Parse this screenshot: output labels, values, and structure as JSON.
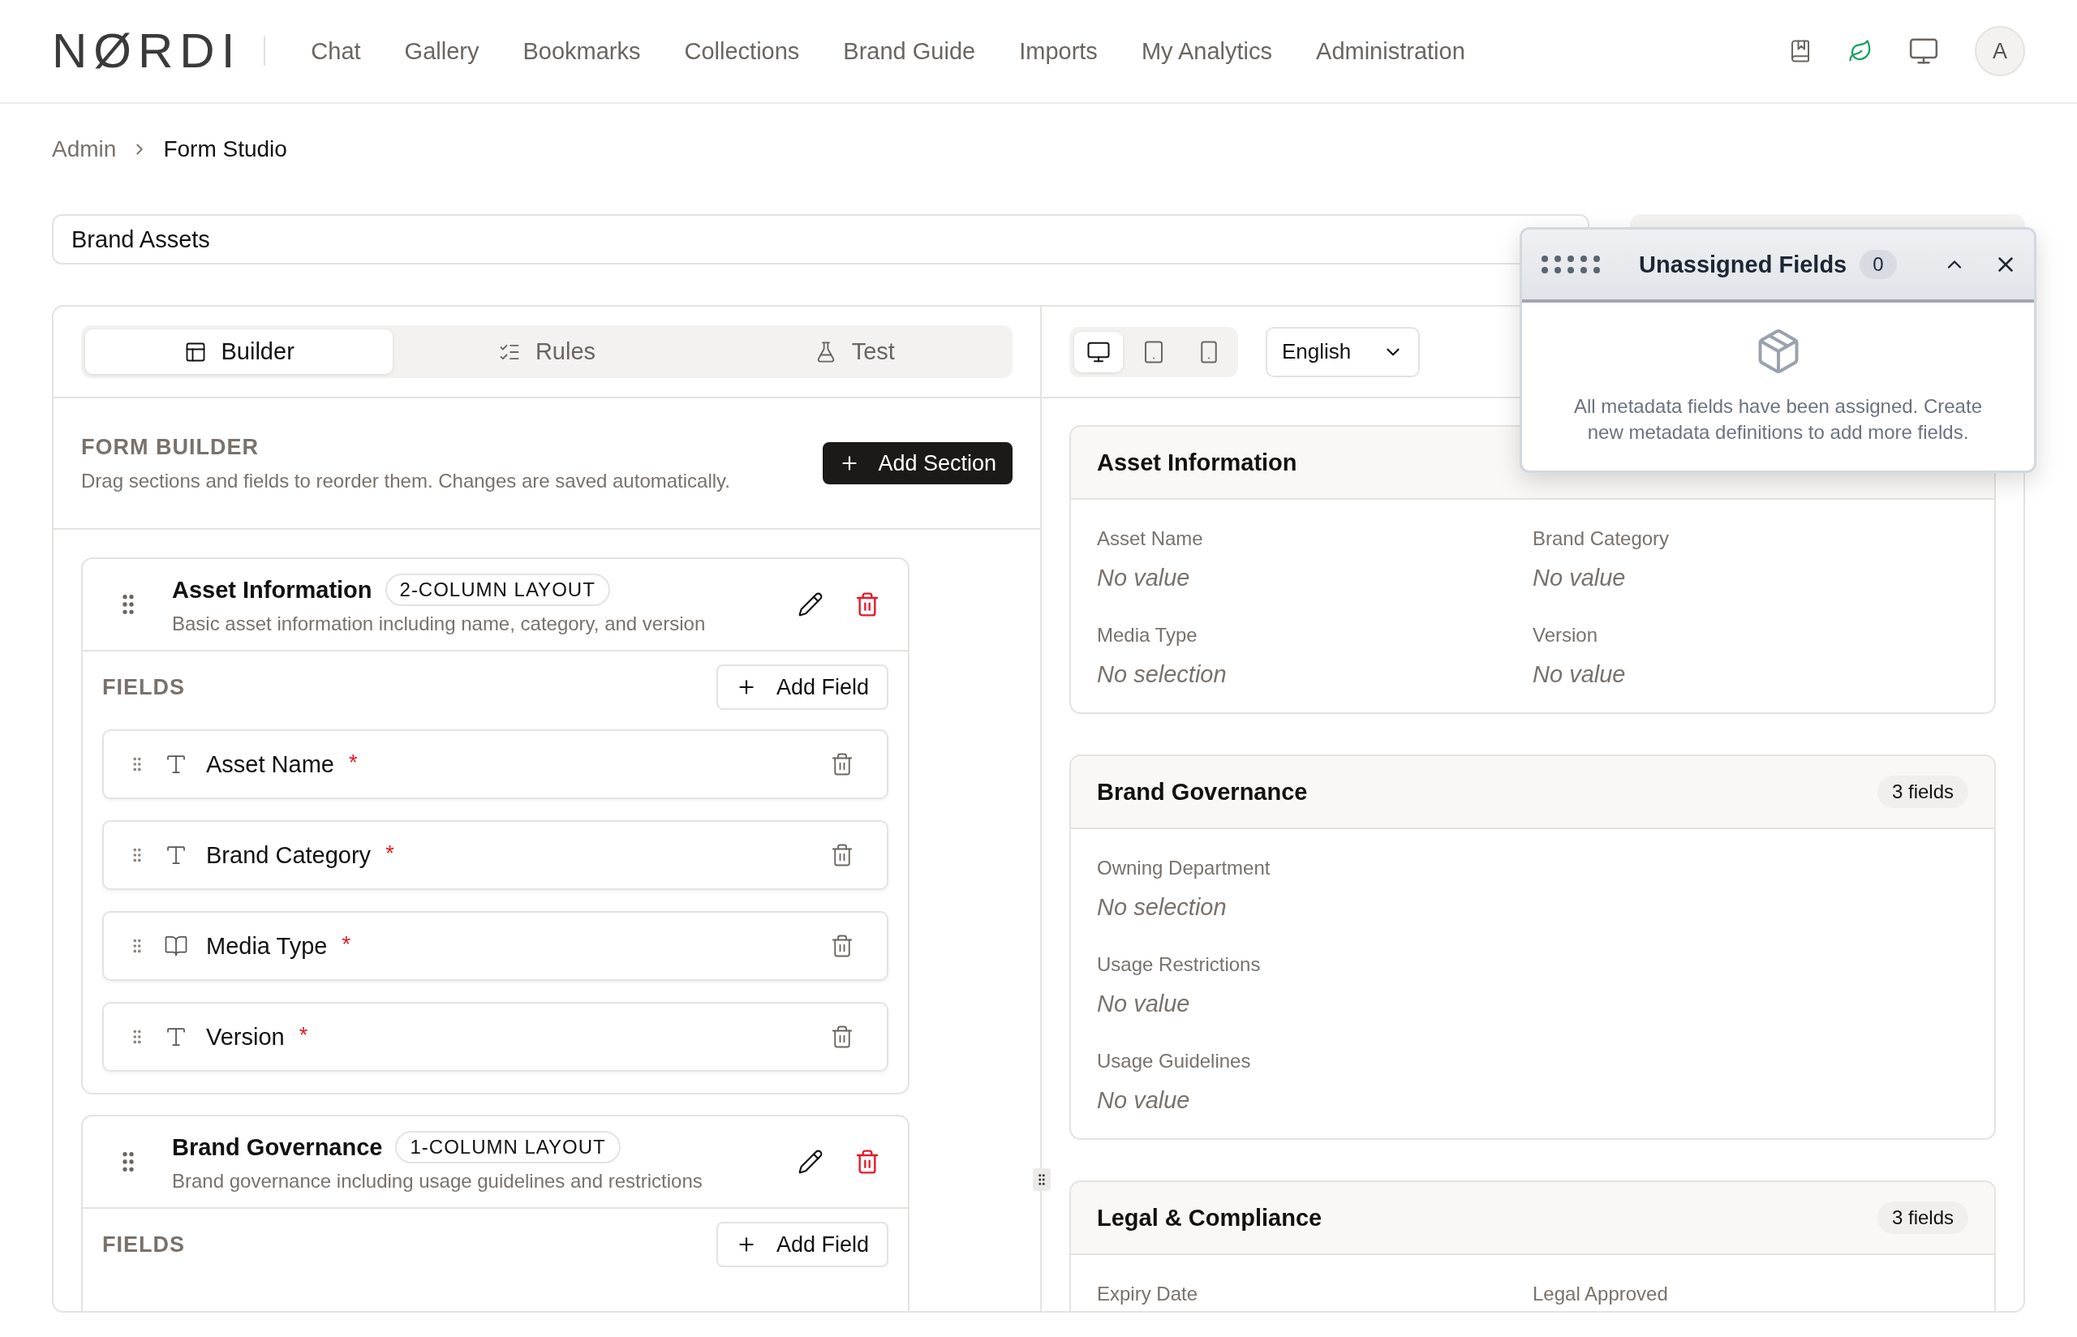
{
  "brand": {
    "logo": "NØRDI"
  },
  "nav": [
    {
      "label": "Chat"
    },
    {
      "label": "Gallery"
    },
    {
      "label": "Bookmarks"
    },
    {
      "label": "Collections"
    },
    {
      "label": "Brand Guide"
    },
    {
      "label": "Imports"
    },
    {
      "label": "My Analytics"
    },
    {
      "label": "Administration"
    }
  ],
  "user": {
    "initial": "A"
  },
  "breadcrumb": [
    {
      "label": "Admin",
      "current": false
    },
    {
      "label": "Form Studio",
      "current": true
    }
  ],
  "form_title": {
    "value": "Brand Assets"
  },
  "builder": {
    "tabs": [
      {
        "label": "Builder",
        "kind": "layout",
        "selected": true
      },
      {
        "label": "Rules",
        "kind": "rules",
        "selected": false
      },
      {
        "label": "Test",
        "kind": "test",
        "selected": false
      }
    ],
    "heading": "FORM BUILDER",
    "description": "Drag sections and fields to reorder them. Changes are saved automatically.",
    "add_section": "Add Section",
    "sections": [
      {
        "title": "Asset Information",
        "layout": "2-COLUMN LAYOUT",
        "description": "Basic asset information including name, category, and version",
        "fields_heading": "FIELDS",
        "add_field": "Add Field",
        "fields": [
          {
            "label": "Asset Name",
            "kind": "text",
            "required_mark": "*"
          },
          {
            "label": "Brand Category",
            "kind": "text",
            "required_mark": "*"
          },
          {
            "label": "Media Type",
            "kind": "book",
            "required_mark": "*"
          },
          {
            "label": "Version",
            "kind": "text",
            "required_mark": "*"
          }
        ]
      },
      {
        "title": "Brand Governance",
        "layout": "1-COLUMN LAYOUT",
        "description": "Brand governance including usage guidelines and restrictions",
        "fields_heading": "FIELDS",
        "add_field": "Add Field"
      }
    ]
  },
  "preview": {
    "devices": [
      {
        "kind": "desktop",
        "selected": true
      },
      {
        "kind": "tablet",
        "selected": false
      },
      {
        "kind": "mobile",
        "selected": false
      }
    ],
    "language": "English",
    "sections": [
      {
        "title": "Asset Information",
        "kind": "two_column",
        "fields": [
          {
            "label": "Asset Name",
            "value": "No value"
          },
          {
            "label": "Brand Category",
            "value": "No value"
          },
          {
            "label": "Media Type",
            "value": "No selection"
          },
          {
            "label": "Version",
            "value": "No value"
          }
        ]
      },
      {
        "title": "Brand Governance",
        "count": "3 fields",
        "kind": "one_column",
        "fields": [
          {
            "label": "Owning Department",
            "value": "No selection"
          },
          {
            "label": "Usage Restrictions",
            "value": "No value"
          },
          {
            "label": "Usage Guidelines",
            "value": "No value"
          }
        ]
      },
      {
        "title": "Legal & Compliance",
        "count": "3 fields",
        "kind": "two_column",
        "fields": [
          {
            "label": "Expiry Date"
          },
          {
            "label": "Legal Approved"
          }
        ]
      }
    ]
  },
  "unassigned_panel": {
    "title": "Unassigned Fields",
    "count": "0",
    "message": "All metadata fields have been assigned. Create new metadata definitions to add more fields."
  }
}
